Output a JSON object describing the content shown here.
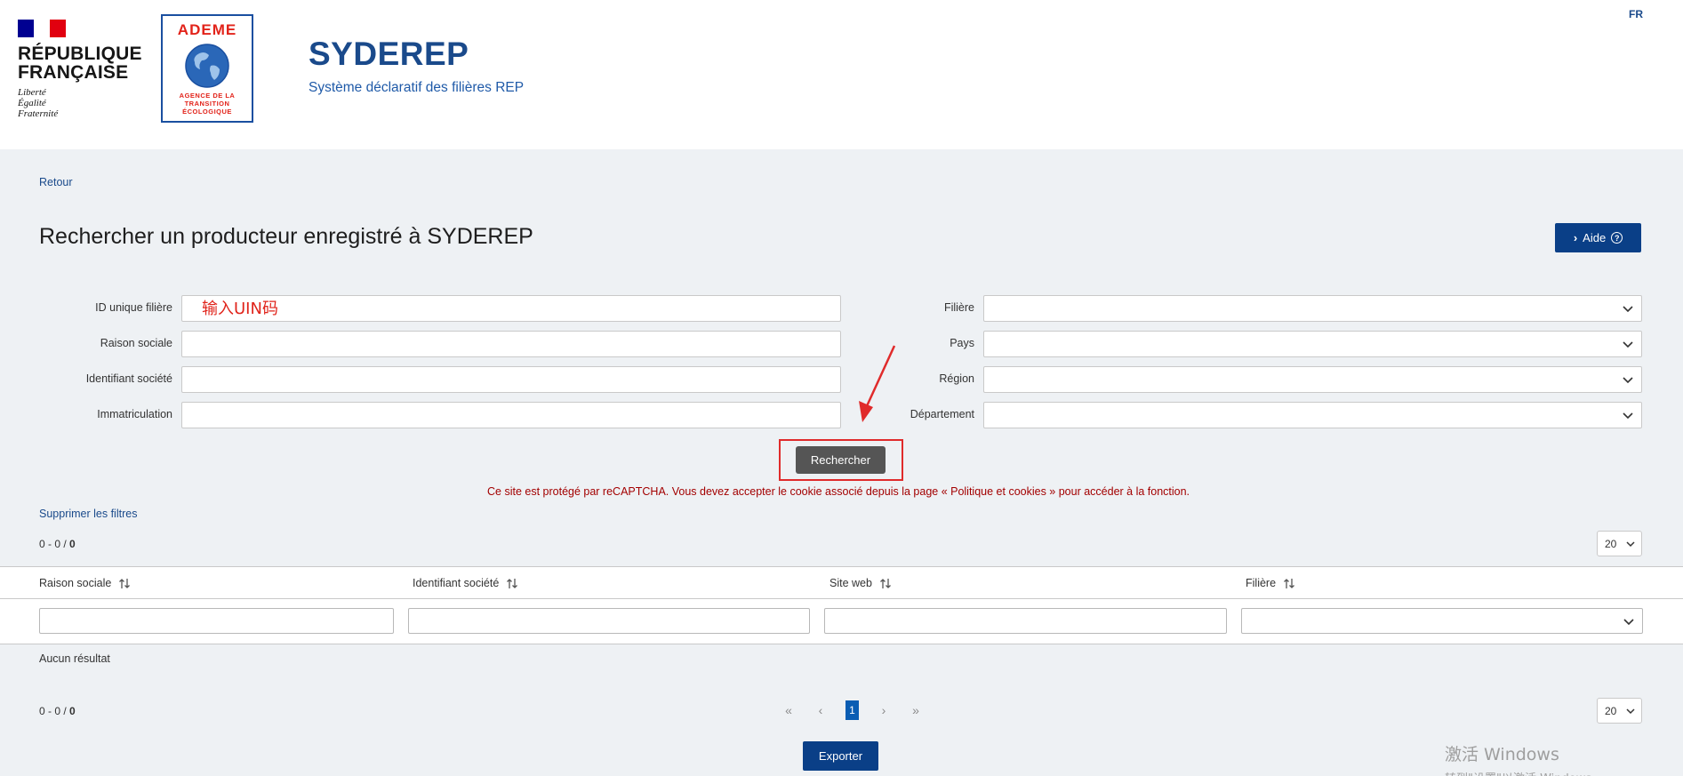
{
  "header": {
    "rf_name_line1": "RÉPUBLIQUE",
    "rf_name_line2": "FRANÇAISE",
    "rf_motto_1": "Liberté",
    "rf_motto_2": "Égalité",
    "rf_motto_3": "Fraternité",
    "ademe_title": "ADEME",
    "ademe_sub_1": "AGENCE DE LA",
    "ademe_sub_2": "TRANSITION",
    "ademe_sub_3": "ÉCOLOGIQUE",
    "brand_title": "SYDEREP",
    "brand_subtitle": "Système déclaratif des filières REP",
    "language": "FR"
  },
  "nav": {
    "back_label": "Retour"
  },
  "page": {
    "title": "Rechercher un producteur enregistré à SYDEREP",
    "help_label": "Aide",
    "help_icons": {
      "chevron": "chevron-right-icon",
      "help": "question-circle-icon"
    }
  },
  "search_form": {
    "left_fields": [
      {
        "label": "ID unique filière",
        "value": "",
        "placeholder": "输入UIN码"
      },
      {
        "label": "Raison sociale",
        "value": "",
        "placeholder": ""
      },
      {
        "label": "Identifiant société",
        "value": "",
        "placeholder": ""
      },
      {
        "label": "Immatriculation",
        "value": "",
        "placeholder": ""
      }
    ],
    "right_fields": [
      {
        "label": "Filière",
        "value": ""
      },
      {
        "label": "Pays",
        "value": ""
      },
      {
        "label": "Région",
        "value": ""
      },
      {
        "label": "Département",
        "value": ""
      }
    ],
    "search_label": "Rechercher",
    "captcha_notice": "Ce site est protégé par reCAPTCHA. Vous devez accepter le cookie associé depuis la page « Politique et cookies » pour accéder à la fonction.",
    "clear_filters_label": "Supprimer les filtres"
  },
  "results": {
    "range": "0 - 0 / ",
    "total": "0",
    "per_page": "20",
    "columns": [
      {
        "label": "Raison sociale"
      },
      {
        "label": "Identifiant société"
      },
      {
        "label": "Site web"
      },
      {
        "label": "Filière"
      }
    ],
    "empty_message": "Aucun résultat",
    "pagination": {
      "first": "«",
      "prev": "‹",
      "current": "1",
      "next": "›",
      "last": "»"
    },
    "export_label": "Exporter"
  },
  "annotations": {
    "highlight_color": "#e02b2b",
    "arrow_color": "#e02b2b"
  },
  "watermark": {
    "line1": "激活 Windows",
    "line2": "转到\"设置\"以激活 Windows。"
  },
  "colors": {
    "primary": "#0a3f87",
    "brand": "#1a4a8b",
    "page_bg": "#eef1f4",
    "notice": "#a30000"
  }
}
